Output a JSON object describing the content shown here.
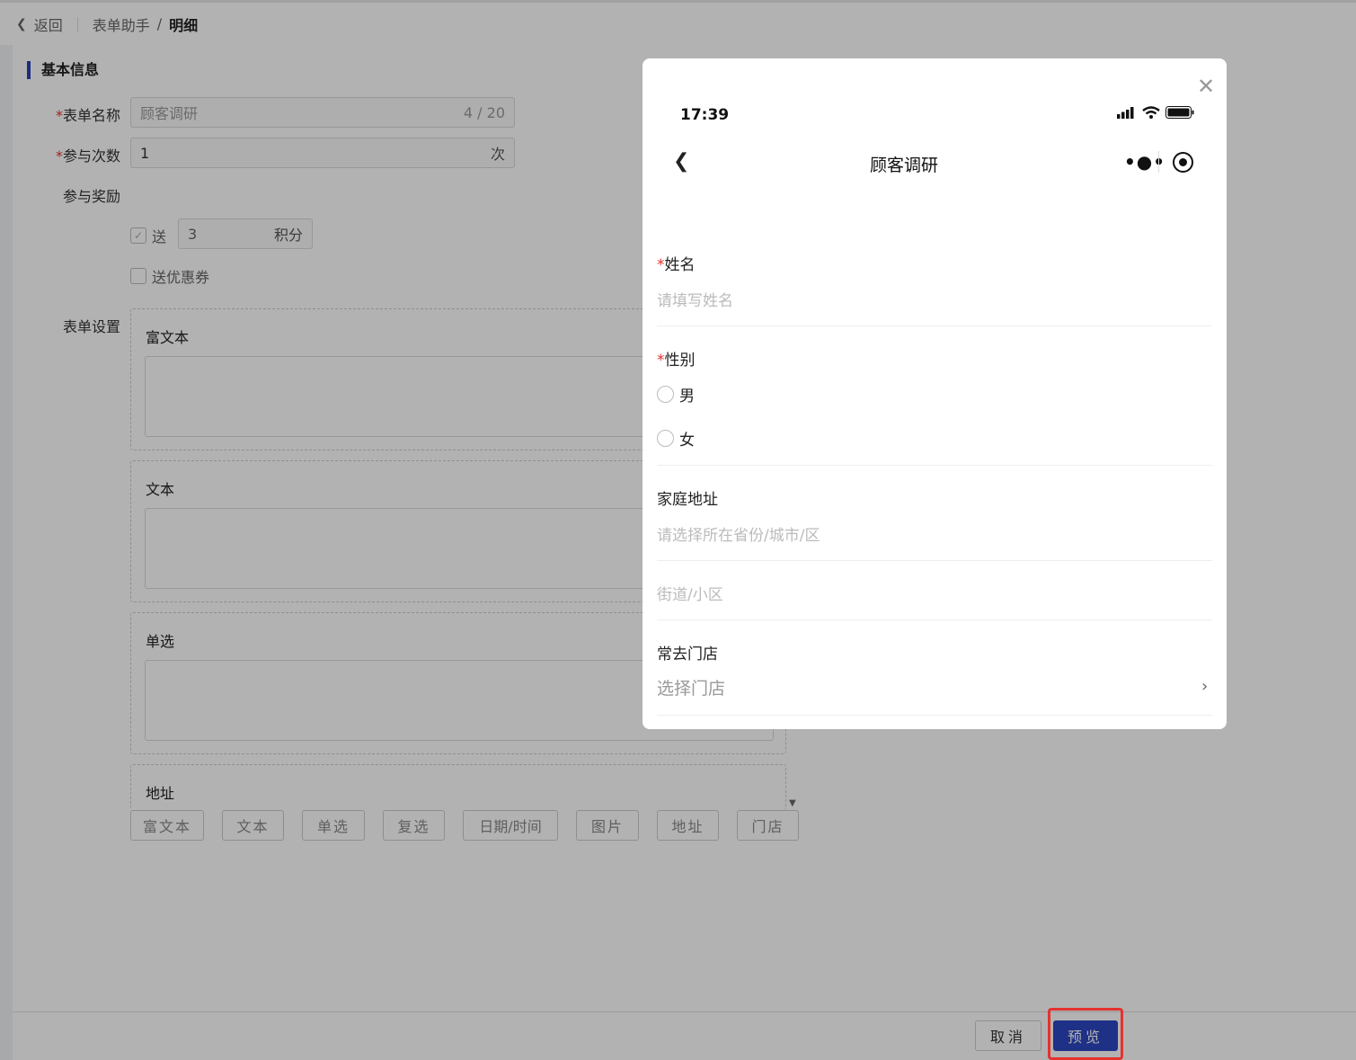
{
  "header": {
    "back_label": "返回",
    "breadcrumb_parent": "表单助手",
    "breadcrumb_sep": "/",
    "breadcrumb_current": "明细"
  },
  "form": {
    "section_title": "基本信息",
    "name_label": "表单名称",
    "name_value": "顾客调研",
    "name_counter": "4 / 20",
    "times_label": "参与次数",
    "times_value": "1",
    "times_suffix": "次",
    "reward_label": "参与奖励",
    "reward_points_check": "送",
    "reward_points_value": "3",
    "reward_points_suffix": "积分",
    "reward_coupon_check": "送优惠券",
    "settings_label": "表单设置",
    "fields": [
      {
        "title": "富文本"
      },
      {
        "title": "文本"
      },
      {
        "title": "单选"
      },
      {
        "title": "地址"
      }
    ],
    "toolbar": [
      "富文本",
      "文本",
      "单选",
      "复选",
      "日期/时间",
      "图片",
      "地址",
      "门店"
    ]
  },
  "footer": {
    "cancel_label": "取消",
    "preview_label": "预览"
  },
  "preview": {
    "status_time": "17:39",
    "title": "顾客调研",
    "name_label": "姓名",
    "name_placeholder": "请填写姓名",
    "gender_label": "性别",
    "gender_options": [
      "男",
      "女"
    ],
    "address_label": "家庭地址",
    "address_region_placeholder": "请选择所在省份/城市/区",
    "address_street_placeholder": "街道/小区",
    "store_label": "常去门店",
    "store_placeholder": "选择门店"
  }
}
